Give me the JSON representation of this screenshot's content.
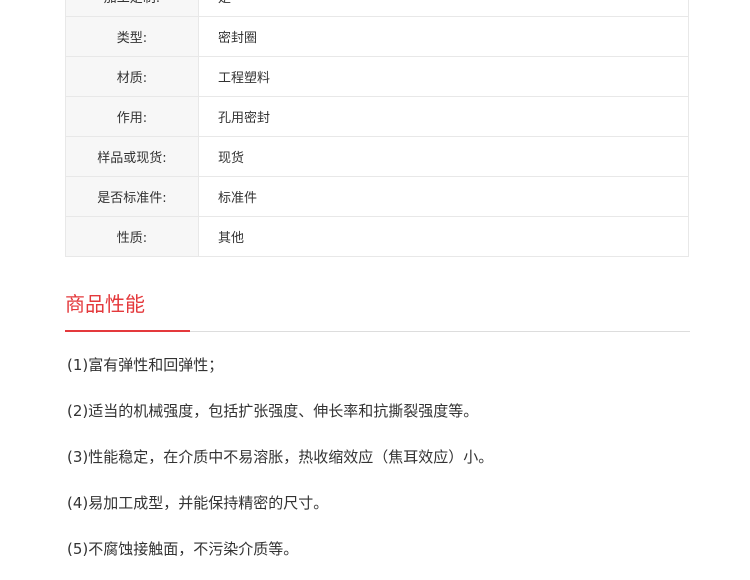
{
  "spec_table": {
    "rows": [
      {
        "label": "加工定制:",
        "value": "是"
      },
      {
        "label": "类型:",
        "value": "密封圈"
      },
      {
        "label": "材质:",
        "value": "工程塑料"
      },
      {
        "label": "作用:",
        "value": "孔用密封"
      },
      {
        "label": "样品或现货:",
        "value": "现货"
      },
      {
        "label": "是否标准件:",
        "value": "标准件"
      },
      {
        "label": "性质:",
        "value": "其他"
      }
    ]
  },
  "section": {
    "title": "商品性能"
  },
  "performance": {
    "items": [
      "(1)富有弹性和回弹性；",
      "(2)适当的机械强度，包括扩张强度、伸长率和抗撕裂强度等。",
      "(3)性能稳定，在介质中不易溶胀，热收缩效应（焦耳效应）小。",
      "(4)易加工成型，并能保持精密的尺寸。",
      "(5)不腐蚀接触面，不污染介质等。"
    ]
  },
  "colors": {
    "accent": "#e4393c",
    "label_bg": "#f7f7f7",
    "border": "#e8e8e8",
    "text": "#333333"
  }
}
